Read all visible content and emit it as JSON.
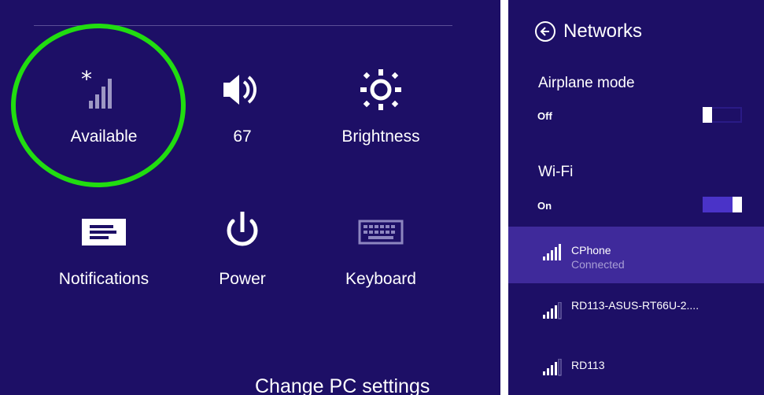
{
  "quick_settings": {
    "network_label": "Available",
    "volume_label": "67",
    "brightness_label": "Brightness",
    "notifications_label": "Notifications",
    "power_label": "Power",
    "keyboard_label": "Keyboard",
    "change_pc_settings": "Change PC settings"
  },
  "networks_panel": {
    "title": "Networks",
    "airplane_mode": {
      "title": "Airplane mode",
      "state": "Off",
      "enabled": false
    },
    "wifi": {
      "title": "Wi-Fi",
      "state": "On",
      "enabled": true
    },
    "networks": [
      {
        "name": "CPhone",
        "status": "Connected",
        "signal_bars": 4
      },
      {
        "name": "RD113-ASUS-RT66U-2....",
        "status": "",
        "signal_bars": 3
      },
      {
        "name": "RD113",
        "status": "",
        "signal_bars": 3
      }
    ]
  },
  "colors": {
    "background": "#1d0f66",
    "highlight_ring": "#21dd10",
    "connected_row": "#3f2a9b",
    "accent": "#2a1a86"
  },
  "icons": [
    "network-icon",
    "volume-icon",
    "brightness-icon",
    "notifications-icon",
    "power-icon",
    "keyboard-icon",
    "back-arrow-icon",
    "wifi-signal-icon"
  ]
}
